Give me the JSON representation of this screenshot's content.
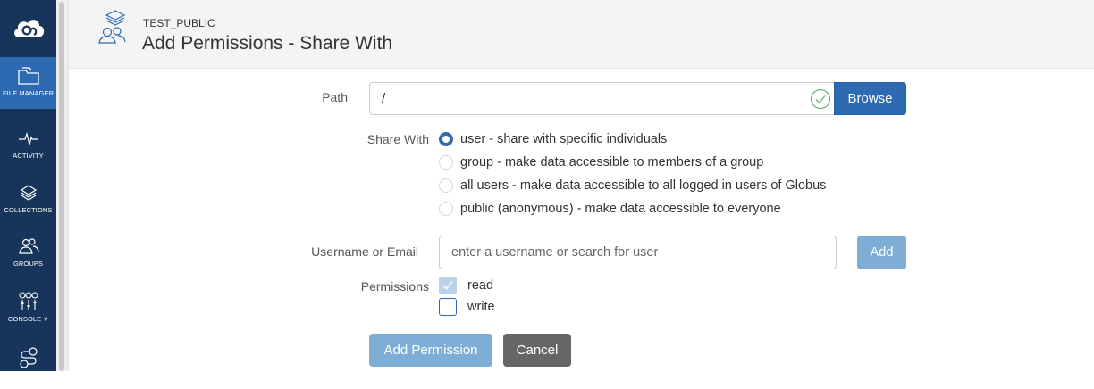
{
  "nav": {
    "logo_icon": "globus-cloud-logo-icon",
    "items": [
      {
        "label": "FILE MANAGER",
        "icon": "folder-icon",
        "active": true
      },
      {
        "label": "ACTIVITY",
        "icon": "pulse-icon",
        "active": false
      },
      {
        "label": "COLLECTIONS",
        "icon": "layers-icon",
        "active": false
      },
      {
        "label": "GROUPS",
        "icon": "people-icon",
        "active": false
      },
      {
        "label": "CONSOLE",
        "icon": "sliders-icon",
        "active": false
      },
      {
        "label": "",
        "icon": "flows-icon",
        "active": false
      }
    ],
    "console_caret": "∨"
  },
  "header": {
    "collection_name": "TEST_PUBLIC",
    "title": "Add Permissions - Share With",
    "icon": "shared-collection-icon"
  },
  "form": {
    "path_label": "Path",
    "path_value": "/",
    "path_valid_icon": "check-circle-icon",
    "browse_label": "Browse",
    "share_with_label": "Share With",
    "share_options": [
      {
        "label": "user - share with specific individuals",
        "checked": true
      },
      {
        "label": "group - make data accessible to members of a group",
        "checked": false
      },
      {
        "label": "all users - make data accessible to all logged in users of Globus",
        "checked": false
      },
      {
        "label": "public (anonymous) - make data accessible to everyone",
        "checked": false
      }
    ],
    "username_label": "Username or Email",
    "username_value": "",
    "username_placeholder": "enter a username or search for user",
    "add_label": "Add",
    "permissions_label": "Permissions",
    "permissions": [
      {
        "label": "read",
        "checked": true
      },
      {
        "label": "write",
        "checked": false
      }
    ],
    "add_permission_label": "Add Permission",
    "cancel_label": "Cancel"
  },
  "colors": {
    "nav_bg": "#17345b",
    "nav_active": "#2d6ab1",
    "primary": "#2d6ab1",
    "primary_disabled": "#7eaed6",
    "cancel": "#666666"
  }
}
